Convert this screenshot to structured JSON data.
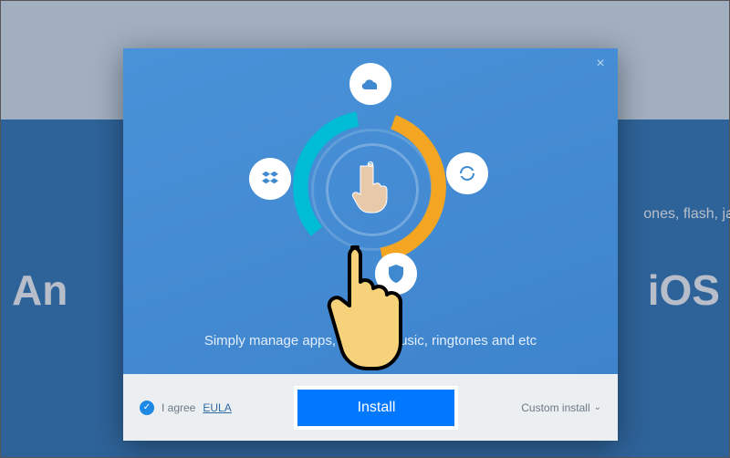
{
  "background": {
    "text_left_fragment": "An",
    "text_right_fragment": "iOS",
    "text_mid_right_fragment": "ones, flash, ja"
  },
  "modal": {
    "tagline": "Simply manage apps, photos, music, ringtones and etc",
    "close_label": "×"
  },
  "footer": {
    "agree_label": "I agree",
    "eula_label": "EULA",
    "install_label": "Install",
    "custom_label": "Custom install"
  }
}
